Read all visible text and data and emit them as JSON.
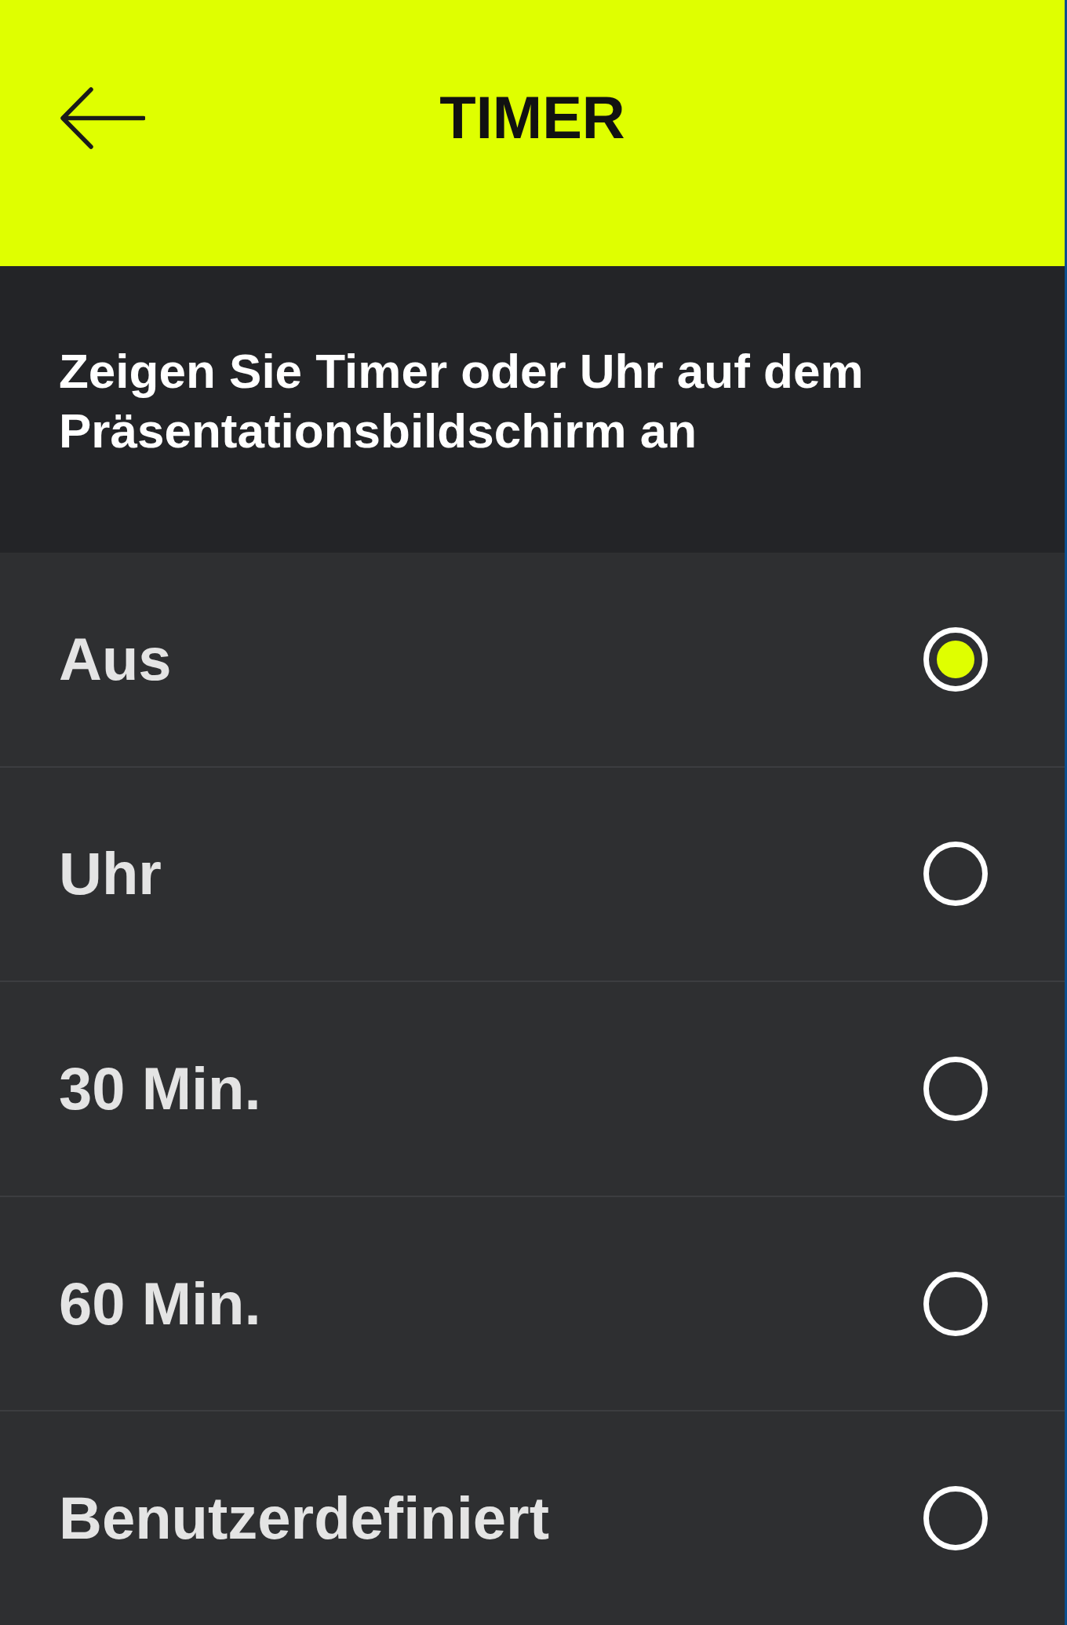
{
  "header": {
    "title": "TIMER"
  },
  "description": "Zeigen Sie Timer oder Uhr auf dem Präsentationsbildschirm an",
  "options": [
    {
      "label": "Aus",
      "selected": true
    },
    {
      "label": "Uhr",
      "selected": false
    },
    {
      "label": "30 Min.",
      "selected": false
    },
    {
      "label": "60 Min.",
      "selected": false
    },
    {
      "label": "Benutzerdefiniert",
      "selected": false
    }
  ]
}
